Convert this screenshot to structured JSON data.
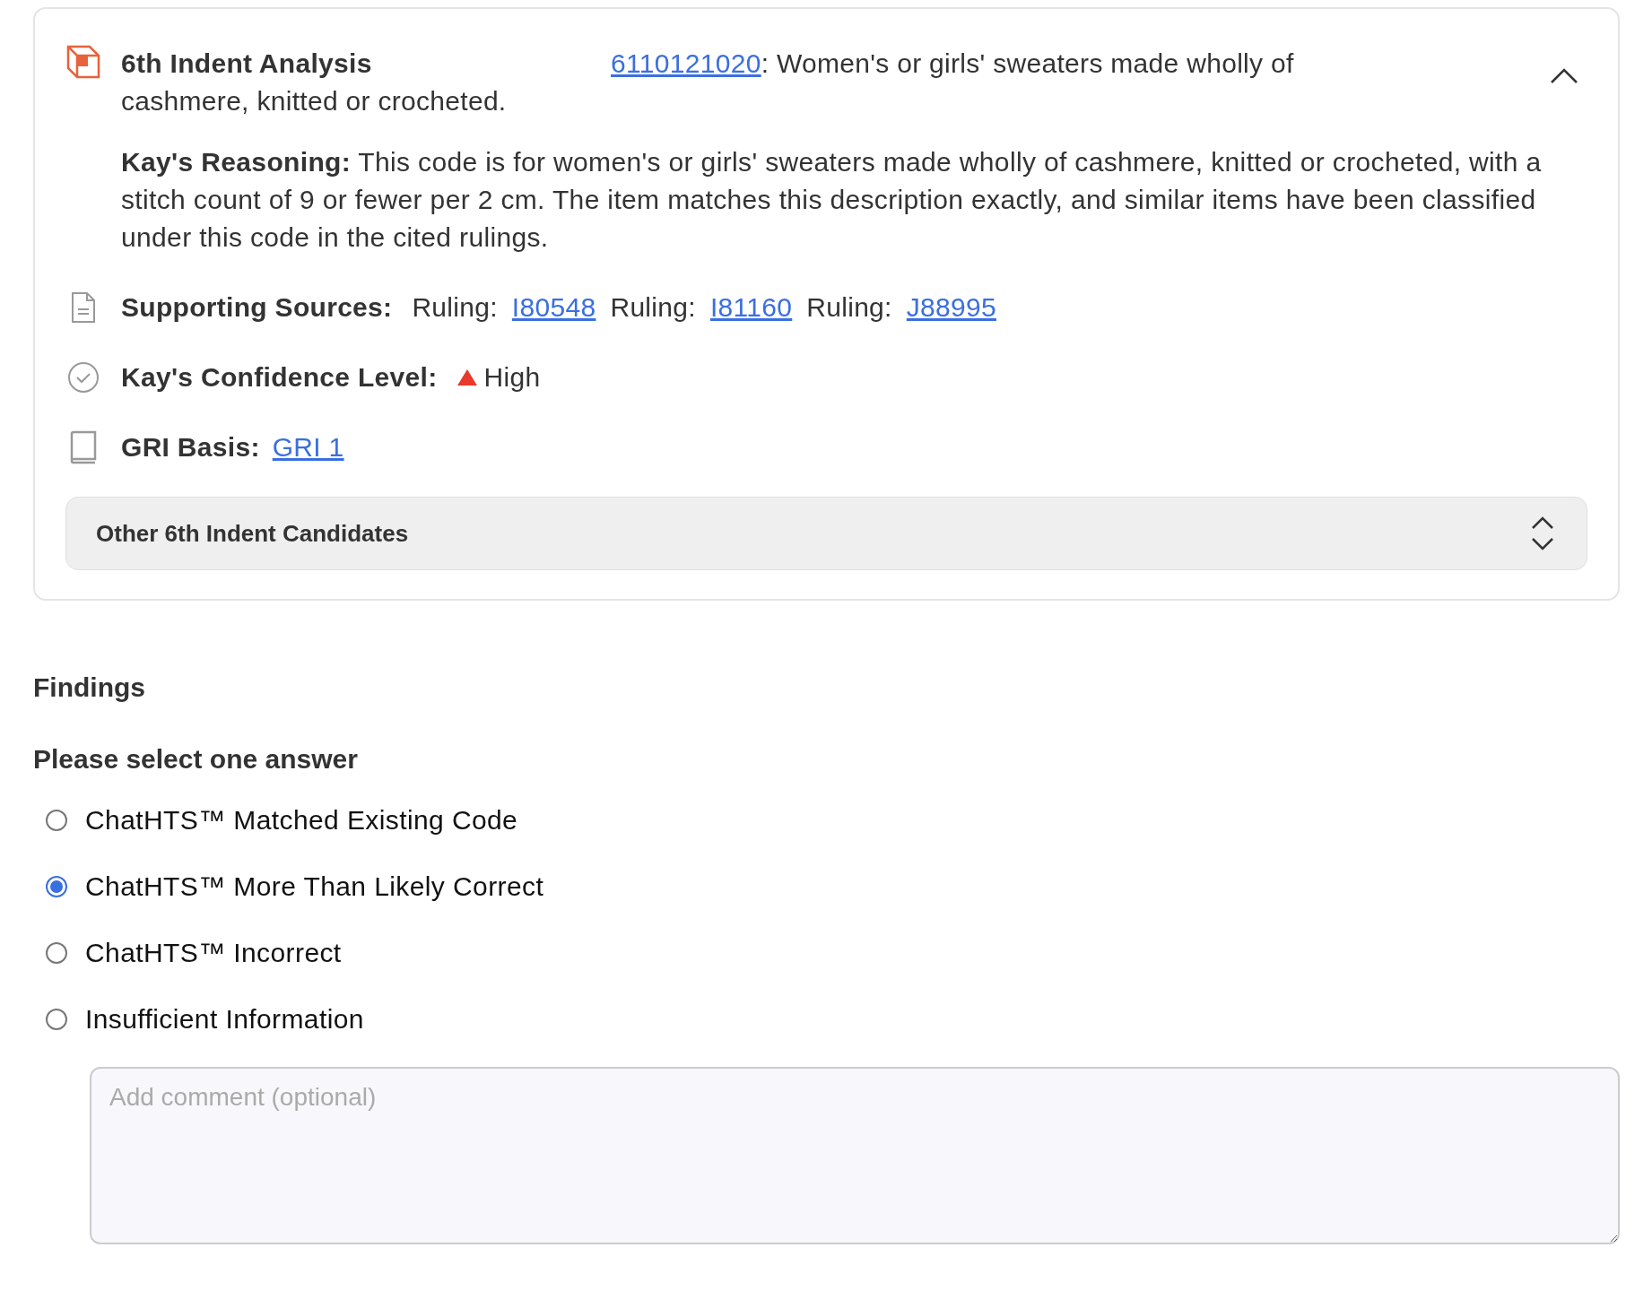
{
  "analysis": {
    "title": "6th Indent Analysis",
    "code": "6110121020",
    "description": ": Women's or girls' sweaters made wholly of cashmere, knitted or crocheted.",
    "expanded": true,
    "reasoning": {
      "label": "Kay's Reasoning:",
      "text": "This code is for women's or girls' sweaters made wholly of cashmere, knitted or crocheted, with a stitch count of 9 or fewer per 2 cm. The item matches this description exactly, and similar items have been classified under this code in the cited rulings."
    },
    "supporting_sources": {
      "label": "Supporting Sources:",
      "rulings": [
        {
          "prefix": "Ruling:",
          "code": "I80548"
        },
        {
          "prefix": "Ruling:",
          "code": "I81160"
        },
        {
          "prefix": "Ruling:",
          "code": "J88995"
        }
      ]
    },
    "confidence": {
      "label": "Kay's Confidence Level:",
      "value": "High"
    },
    "gri_basis": {
      "label": "GRI Basis:",
      "link": "GRI 1"
    },
    "other_candidates": {
      "label": "Other 6th Indent Candidates"
    }
  },
  "findings": {
    "title": "Findings",
    "question": "Please select one answer",
    "options": [
      {
        "label": "ChatHTS™ Matched Existing Code",
        "selected": false
      },
      {
        "label": "ChatHTS™ More Than Likely Correct",
        "selected": true
      },
      {
        "label": "ChatHTS™ Incorrect",
        "selected": false
      },
      {
        "label": "Insufficient Information",
        "selected": false
      }
    ],
    "comment": {
      "placeholder": "Add comment (optional)"
    }
  }
}
